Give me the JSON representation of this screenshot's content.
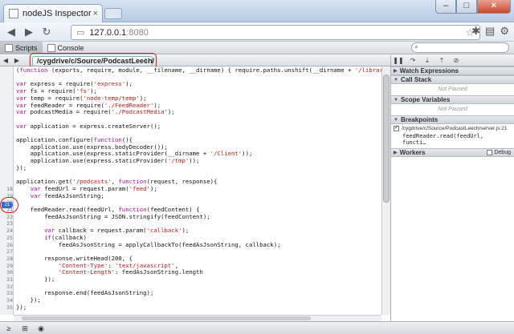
{
  "window": {
    "tab_title": "nodeJS Inspector",
    "tab_close": "×",
    "min": "–",
    "max": "□",
    "close": "×"
  },
  "toolbar": {
    "back": "◀",
    "forward": "▶",
    "reload": "↻",
    "url_host": "127.0.0.1",
    "url_port": ":8080",
    "star": "☆"
  },
  "devtools": {
    "tabs": [
      {
        "label": "Scripts"
      },
      {
        "label": "Console"
      }
    ],
    "search_placeholder": ""
  },
  "scripts": {
    "selected_script": "/cygdrive/c/Source/PodcastLeech/",
    "dropdown_arrow": "⇕",
    "prev": "◀",
    "next": "▶",
    "lines": [
      {
        "n": "",
        "text": "(function (exports, require, module, __filename, __dirname) { require.paths.unshift(__dirname + '/libraries'"
      },
      {
        "n": "",
        "text": ""
      },
      {
        "n": "",
        "text": "var express = require('express');"
      },
      {
        "n": "",
        "text": "var fs = require('fs');"
      },
      {
        "n": "",
        "text": "var temp = require('node-temp/temp');"
      },
      {
        "n": "",
        "text": "var feedReader = require('./FeedReader');"
      },
      {
        "n": "",
        "text": "var podcastMedia = require('./PodcastMedia');"
      },
      {
        "n": "",
        "text": ""
      },
      {
        "n": "",
        "text": "var application = express.createServer();"
      },
      {
        "n": "",
        "text": ""
      },
      {
        "n": "",
        "text": "application.configure(function(){"
      },
      {
        "n": "",
        "text": "    application.use(express.bodyDecoder());"
      },
      {
        "n": "",
        "text": "    application.use(express.staticProvider(__dirname + '/Client'));"
      },
      {
        "n": "",
        "text": "    application.use(express.staticProvider('/tmp'));"
      },
      {
        "n": "",
        "text": "});"
      },
      {
        "n": "",
        "text": ""
      },
      {
        "n": "",
        "text": "application.get('/podcasts', function(request, response){"
      },
      {
        "n": "18",
        "text": "    var feedUrl = request.param('feed');"
      },
      {
        "n": "19",
        "text": "    var feedAsJsonString;"
      },
      {
        "n": "20",
        "text": ""
      },
      {
        "n": "21",
        "text": "    feedReader.read(feedUrl, function(feedContent) {"
      },
      {
        "n": "22",
        "text": "        feedAsJsonString = JSON.stringify(feedContent);"
      },
      {
        "n": "23",
        "text": ""
      },
      {
        "n": "24",
        "text": "        var callback = request.param('callback');"
      },
      {
        "n": "25",
        "text": "        if(callback)"
      },
      {
        "n": "26",
        "text": "            feedAsJsonString = applyCallbackTo(feedAsJsonString, callback);"
      },
      {
        "n": "27",
        "text": ""
      },
      {
        "n": "28",
        "text": "        response.writeHead(200, {"
      },
      {
        "n": "29",
        "text": "            'Content-Type': 'text/javascript',"
      },
      {
        "n": "30",
        "text": "            'Content-Length': feedAsJsonString.length"
      },
      {
        "n": "31",
        "text": "        });"
      },
      {
        "n": "32",
        "text": ""
      },
      {
        "n": "33",
        "text": "        response.end(feedAsJsonString);"
      },
      {
        "n": "34",
        "text": "    });"
      },
      {
        "n": "35",
        "text": "});"
      }
    ],
    "breakpoint_line": "21"
  },
  "sidebar": {
    "controls": [
      "❚❚",
      "↷",
      "⇣",
      "⇡",
      "⊘"
    ],
    "sections": {
      "watch": "Watch Expressions",
      "callstack": "Call Stack",
      "callstack_body": "Not Paused",
      "scope": "Scope Variables",
      "scope_body": "Not Paused",
      "breakpoints": "Breakpoints",
      "workers": "Workers",
      "debug": "Debug"
    },
    "breakpoint": {
      "location": "/cygdrive/c/Source/PodcastLeech/server.js:21",
      "code": "feedReader.read(feedUrl, functi…"
    }
  },
  "statusbar": [
    "≥",
    "⊞",
    "◉"
  ]
}
